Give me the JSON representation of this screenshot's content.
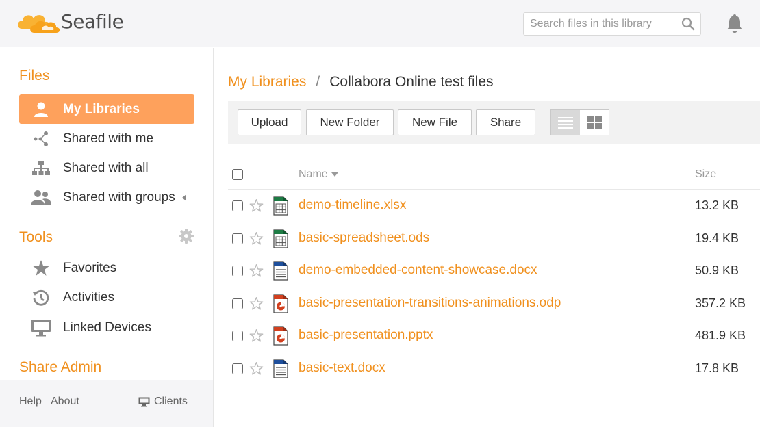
{
  "header": {
    "logo_text": "Seafile",
    "search_placeholder": "Search files in this library",
    "accent_color": "#f0901e"
  },
  "sidebar": {
    "files_heading": "Files",
    "files_items": [
      {
        "label": "My Libraries",
        "icon": "user-icon",
        "active": true
      },
      {
        "label": "Shared with me",
        "icon": "share-icon",
        "active": false
      },
      {
        "label": "Shared with all",
        "icon": "org-chart-icon",
        "active": false
      },
      {
        "label": "Shared with groups",
        "icon": "group-icon",
        "active": false
      }
    ],
    "tools_heading": "Tools",
    "tools_items": [
      {
        "label": "Favorites",
        "icon": "star-icon"
      },
      {
        "label": "Activities",
        "icon": "history-icon"
      },
      {
        "label": "Linked Devices",
        "icon": "monitor-icon"
      }
    ],
    "share_admin_heading": "Share Admin",
    "footer": {
      "help": "Help",
      "about": "About",
      "clients": "Clients"
    }
  },
  "main": {
    "breadcrumb": {
      "root": "My Libraries",
      "separator": "/",
      "current": "Collabora Online test files"
    },
    "toolbar": {
      "upload": "Upload",
      "new_folder": "New Folder",
      "new_file": "New File",
      "share": "Share"
    },
    "table": {
      "col_name": "Name",
      "col_size": "Size",
      "rows": [
        {
          "name": "demo-timeline.xlsx",
          "size": "13.2 KB",
          "type": "spreadsheet"
        },
        {
          "name": "basic-spreadsheet.ods",
          "size": "19.4 KB",
          "type": "spreadsheet"
        },
        {
          "name": "demo-embedded-content-showcase.docx",
          "size": "50.9 KB",
          "type": "document"
        },
        {
          "name": "basic-presentation-transitions-animations.odp",
          "size": "357.2 KB",
          "type": "presentation"
        },
        {
          "name": "basic-presentation.pptx",
          "size": "481.9 KB",
          "type": "presentation"
        },
        {
          "name": "basic-text.docx",
          "size": "17.8 KB",
          "type": "document"
        }
      ]
    }
  }
}
